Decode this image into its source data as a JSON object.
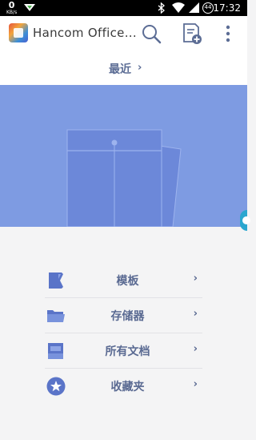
{
  "status": {
    "speed": "0",
    "speed_unit": "KB/s",
    "battery": "44",
    "time": "17:32"
  },
  "appbar": {
    "title": "Hancom Office...",
    "icons": [
      "app-logo",
      "search-icon",
      "new-document-icon",
      "more-vert-icon"
    ]
  },
  "recent": {
    "label": "最近",
    "chevron": "›"
  },
  "menu": {
    "items": [
      {
        "label": "模板",
        "icon": "template-icon",
        "arrow": "›"
      },
      {
        "label": "存储器",
        "icon": "folder-icon",
        "arrow": "›"
      },
      {
        "label": "所有文档",
        "icon": "documents-icon",
        "arrow": "›"
      },
      {
        "label": "收藏夹",
        "icon": "star-icon",
        "arrow": "›"
      }
    ]
  },
  "colors": {
    "accent": "#5c6d95",
    "hero_bg": "#7e9be2",
    "envelope": "#6c88d9",
    "side_tab": "#2ba7cf"
  }
}
